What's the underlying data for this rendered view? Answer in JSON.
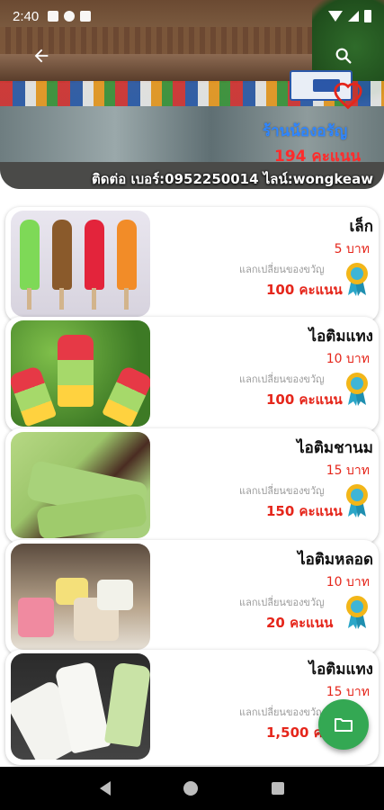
{
  "status_bar": {
    "time": "2:40"
  },
  "header": {
    "shop_name": "ร้านน้องอรัญ",
    "points": "194 คะแนน",
    "contact": "ติดต่อ เบอร์:0952250014 ไลน์:wongkeaw"
  },
  "icons": {
    "back": "arrow-left-icon",
    "search": "search-icon",
    "favorite": "heart-icon",
    "fab": "folder-icon",
    "medal": "ribbon-medal-icon"
  },
  "colors": {
    "shop_name": "#2f86ff",
    "points": "#ff2b2b",
    "price": "#e5261b",
    "fab": "#34a853"
  },
  "products": [
    {
      "name": "เล็ก",
      "price": "5 บาท",
      "redeem_label": "แลกเปลี่ยนของขวัญ",
      "points": "100 คะแนน"
    },
    {
      "name": "ไอติมแทง",
      "price": "10 บาท",
      "redeem_label": "แลกเปลี่ยนของขวัญ",
      "points": "100 คะแนน"
    },
    {
      "name": "ไอติมชานม",
      "price": "15 บาท",
      "redeem_label": "แลกเปลี่ยนของขวัญ",
      "points": "150 คะแนน"
    },
    {
      "name": "ไอติมหลอด",
      "price": "10 บาท",
      "redeem_label": "แลกเปลี่ยนของขวัญ",
      "points": "20 คะแนน"
    },
    {
      "name": "ไอติมแทง",
      "price": "15 บาท",
      "redeem_label": "แลกเปลี่ยนของขวัญ",
      "points": "1,500 คะแนน"
    }
  ]
}
